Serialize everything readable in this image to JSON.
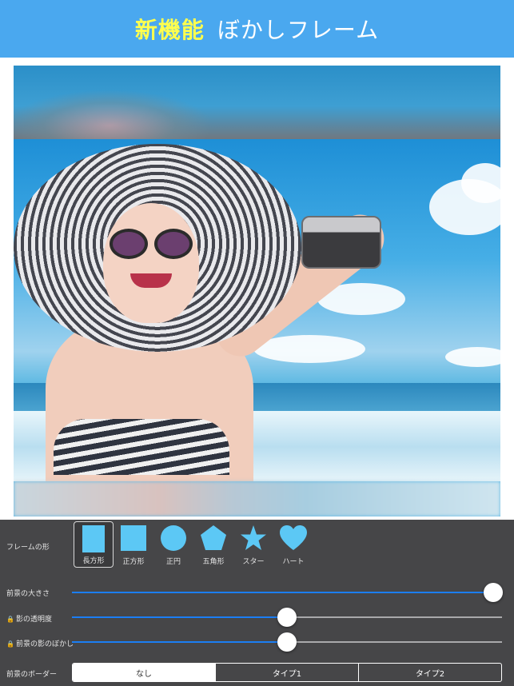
{
  "banner": {
    "highlight": "新機能",
    "title": "ぼかしフレーム",
    "highlight_color": "#ffff4d",
    "background_color": "#4aa8ef"
  },
  "canvas": {
    "image_description_icon": "photo-icon"
  },
  "controls": {
    "frame_shape_label": "フレームの形",
    "shapes": [
      {
        "label": "長方形",
        "icon": "rectangle-icon",
        "selected": true
      },
      {
        "label": "正方形",
        "icon": "square-icon",
        "selected": false
      },
      {
        "label": "正円",
        "icon": "circle-icon",
        "selected": false
      },
      {
        "label": "五角形",
        "icon": "pentagon-icon",
        "selected": false
      },
      {
        "label": "スター",
        "icon": "star-icon",
        "selected": false
      },
      {
        "label": "ハート",
        "icon": "heart-icon",
        "selected": false
      }
    ],
    "sliders": [
      {
        "label": "前景の大きさ",
        "locked": false,
        "value": 0.98
      },
      {
        "label": "影の透明度",
        "locked": true,
        "value": 0.5
      },
      {
        "label": "前景の影のぼかし",
        "locked": true,
        "value": 0.5
      }
    ],
    "border_label": "前景のボーダー",
    "border_options": [
      "なし",
      "タイプ1",
      "タイプ2"
    ],
    "border_selected": 0,
    "accent_color": "#1b7ef4",
    "shape_color": "#5cc8f5"
  }
}
